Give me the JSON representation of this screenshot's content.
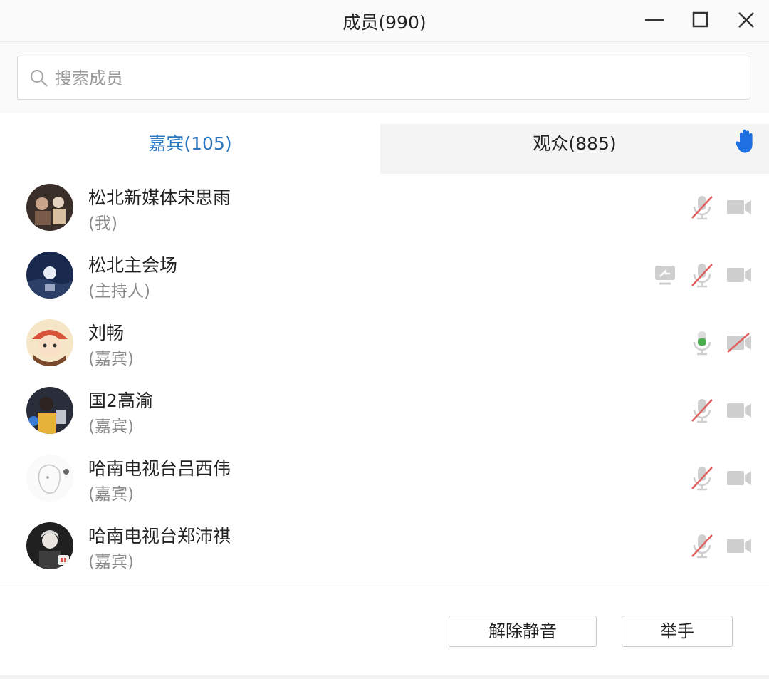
{
  "window": {
    "title": "成员(990)",
    "controls": {
      "minimize_icon": "minimize-icon",
      "maximize_icon": "maximize-icon",
      "close_icon": "close-icon"
    }
  },
  "search": {
    "placeholder": "搜索成员",
    "value": "",
    "icon": "search-icon"
  },
  "tabs": [
    {
      "label": "嘉宾(105)",
      "active": true
    },
    {
      "label": "观众(885)",
      "active": false
    }
  ],
  "raise_hand_icon": {
    "name": "raise-hand-icon",
    "color": "#1e6fe0"
  },
  "members": [
    {
      "name": "松北新媒体宋思雨",
      "role": "(我)",
      "mic": "muted",
      "camera": "off",
      "screen_share": false
    },
    {
      "name": "松北主会场",
      "role": "(主持人)",
      "mic": "muted",
      "camera": "off",
      "screen_share": true
    },
    {
      "name": "刘畅",
      "role": "(嘉宾)",
      "mic": "active",
      "camera": "disabled",
      "screen_share": false
    },
    {
      "name": "国2高渝",
      "role": "(嘉宾)",
      "mic": "muted",
      "camera": "off",
      "screen_share": false
    },
    {
      "name": "哈南电视台吕西伟",
      "role": "(嘉宾)",
      "mic": "muted",
      "camera": "off",
      "screen_share": false
    },
    {
      "name": "哈南电视台郑沛祺",
      "role": "(嘉宾)",
      "mic": "muted",
      "camera": "off",
      "screen_share": false
    }
  ],
  "footer": {
    "unmute_label": "解除静音",
    "raise_hand_label": "举手"
  },
  "colors": {
    "accent": "#2b78c0",
    "mic_active": "#4cb050",
    "muted_slash": "#e06060",
    "icon_gray": "#c8c8c8"
  }
}
